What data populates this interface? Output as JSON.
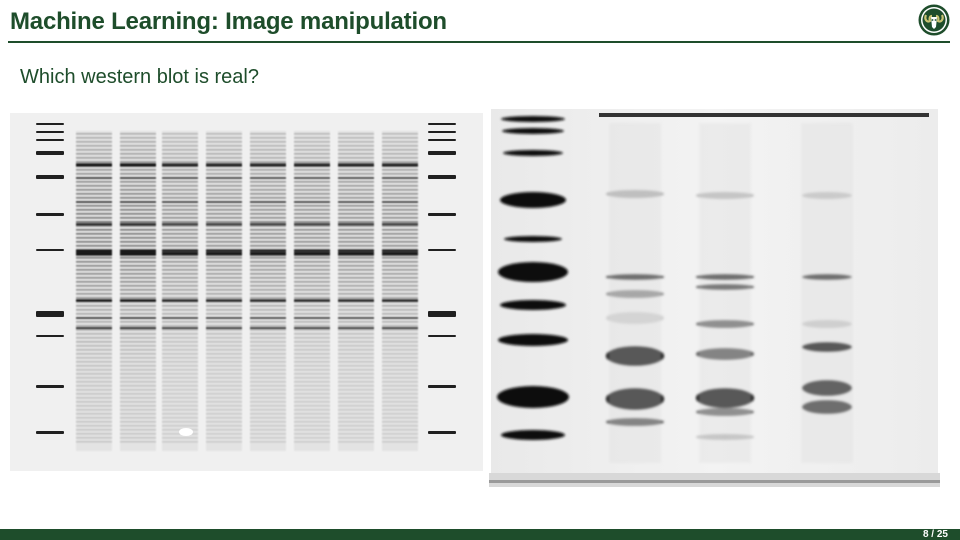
{
  "slide": {
    "title": "Machine Learning: Image manipulation",
    "question": "Which western blot is real?",
    "page_number": "8 / 25"
  },
  "colors": {
    "brand_green": "#1e4d2b",
    "logo_gold": "#c8c372"
  },
  "icons": {
    "logo": "ram-head-logo"
  }
}
